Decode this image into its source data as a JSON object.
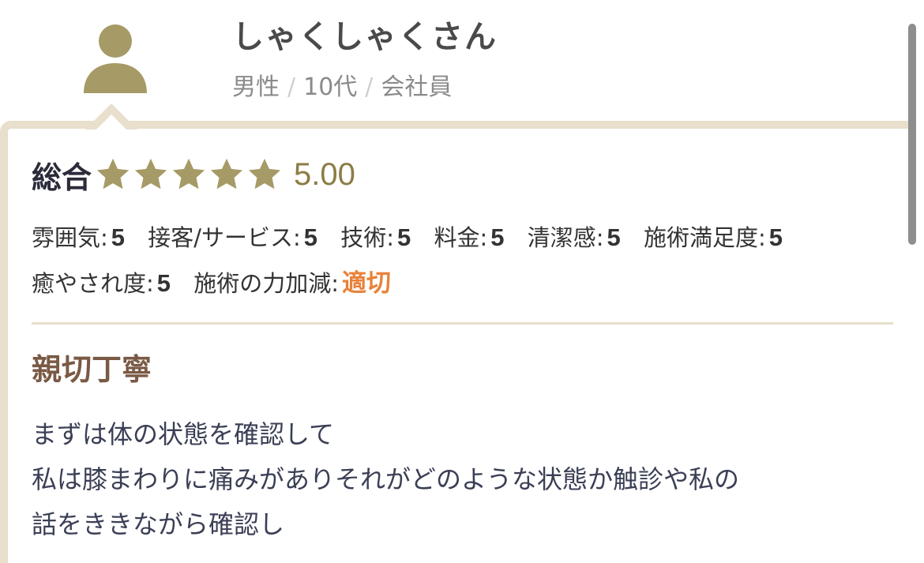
{
  "reviewer": {
    "name": "しゃくしゃくさん",
    "gender": "男性",
    "age": "10代",
    "occupation": "会社員",
    "separator": "/"
  },
  "overall": {
    "label": "総合",
    "stars": 5,
    "score": "5.00"
  },
  "ratings": [
    {
      "label": "雰囲気:",
      "value": "5"
    },
    {
      "label": "接客/サービス:",
      "value": "5"
    },
    {
      "label": "技術:",
      "value": "5"
    },
    {
      "label": "料金:",
      "value": "5"
    },
    {
      "label": "清潔感:",
      "value": "5"
    },
    {
      "label": "施術満足度:",
      "value": "5"
    },
    {
      "label": "癒やされ度:",
      "value": "5"
    },
    {
      "label": "施術の力加減:",
      "value": "適切"
    }
  ],
  "review": {
    "title": "親切丁寧",
    "lines": [
      "まずは体の状態を確認して",
      "私は膝まわりに痛みがありそれがどのような状態か触診や私の",
      "話をききながら確認し"
    ]
  },
  "colors": {
    "accent_gold": "#a69a66",
    "border_beige": "#e8dfcc",
    "title_brown": "#7a5a45",
    "highlight_orange": "#e8823a"
  }
}
